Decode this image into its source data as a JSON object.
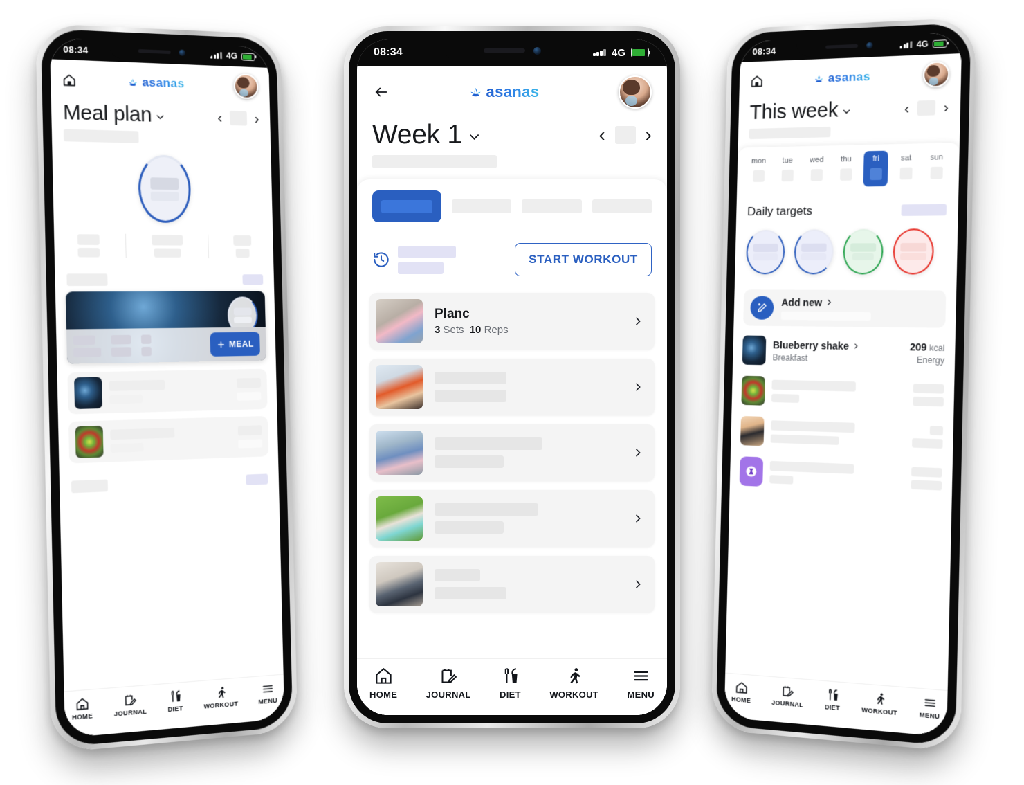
{
  "brand": {
    "name": "asanas",
    "accent": "#2a5fc0",
    "logo_icon": "lotus-icon"
  },
  "status_bar": {
    "time": "08:34",
    "network": "4G",
    "signal_icon": "signal-bars-icon",
    "battery_icon": "battery-icon"
  },
  "bottom_nav": {
    "items": [
      {
        "label": "HOME",
        "icon": "home-icon"
      },
      {
        "label": "JOURNAL",
        "icon": "journal-pencil-icon"
      },
      {
        "label": "DIET",
        "icon": "fork-cup-icon"
      },
      {
        "label": "WORKOUT",
        "icon": "running-person-icon"
      },
      {
        "label": "MENU",
        "icon": "hamburger-menu-icon"
      }
    ]
  },
  "phone_left": {
    "header": {
      "home_icon": "home-icon",
      "avatar": "user-avatar"
    },
    "title": "Meal plan",
    "title_caret": "chevron-down-icon",
    "pager": {
      "prev": "‹",
      "next": "›"
    },
    "meal_card": {
      "add_button_label": "MEAL",
      "add_button_icon": "plus-icon"
    }
  },
  "phone_center": {
    "header": {
      "back_icon": "arrow-left-icon",
      "avatar": "user-avatar"
    },
    "title": "Week 1",
    "title_caret": "chevron-down-icon",
    "pager": {
      "prev": "‹",
      "next": "›"
    },
    "history_icon": "history-clock-icon",
    "start_button_label": "START WORKOUT",
    "exercises": [
      {
        "name": "Planc",
        "sets": "3",
        "sets_label": "Sets",
        "reps": "10",
        "reps_label": "Reps",
        "thumb": "plank-photo",
        "chevron": "chevron-right-icon"
      },
      {
        "name": "",
        "sets": "",
        "sets_label": "",
        "reps": "",
        "reps_label": "",
        "thumb": "crunch-photo",
        "chevron": "chevron-right-icon"
      },
      {
        "name": "",
        "sets": "",
        "sets_label": "",
        "reps": "",
        "reps_label": "",
        "thumb": "mountain-climber-photo",
        "chevron": "chevron-right-icon"
      },
      {
        "name": "",
        "sets": "",
        "sets_label": "",
        "reps": "",
        "reps_label": "",
        "thumb": "stability-ball-photo",
        "chevron": "chevron-right-icon"
      },
      {
        "name": "",
        "sets": "",
        "sets_label": "",
        "reps": "",
        "reps_label": "",
        "thumb": "lunge-photo",
        "chevron": "chevron-right-icon"
      }
    ]
  },
  "phone_right": {
    "header": {
      "home_icon": "home-icon",
      "avatar": "user-avatar"
    },
    "title": "This week",
    "title_caret": "chevron-down-icon",
    "pager": {
      "prev": "‹",
      "next": "›"
    },
    "week_days": [
      {
        "label": "mon",
        "selected": false
      },
      {
        "label": "tue",
        "selected": false
      },
      {
        "label": "wed",
        "selected": false
      },
      {
        "label": "thu",
        "selected": false
      },
      {
        "label": "fri",
        "selected": true
      },
      {
        "label": "sat",
        "selected": false
      },
      {
        "label": "sun",
        "selected": false
      }
    ],
    "daily_targets_label": "Daily targets",
    "target_rings": [
      {
        "color": "#2f5fbd"
      },
      {
        "color": "#2f5fbd"
      },
      {
        "color": "#2aa44f"
      },
      {
        "color": "#e8322a"
      }
    ],
    "add_new": {
      "label": "Add new",
      "chevron": "chevron-right-icon",
      "icon": "magic-pencil-icon"
    },
    "entries": [
      {
        "name": "Blueberry shake",
        "chevron": "chevron-right-icon",
        "meta": "Breakfast",
        "value": "209",
        "unit": "kcal",
        "value_label": "Energy",
        "thumb": "blueberry-photo"
      },
      {
        "name": "",
        "chevron": "",
        "meta": "",
        "value": "",
        "unit": "",
        "value_label": "",
        "thumb": "salad-photo"
      },
      {
        "name": "",
        "chevron": "",
        "meta": "",
        "value": "",
        "unit": "",
        "value_label": "",
        "thumb": "yoga-photo"
      },
      {
        "name": "",
        "chevron": "",
        "meta": "",
        "value": "",
        "unit": "",
        "value_label": "",
        "thumb": "supplement-icon-tile"
      }
    ]
  }
}
